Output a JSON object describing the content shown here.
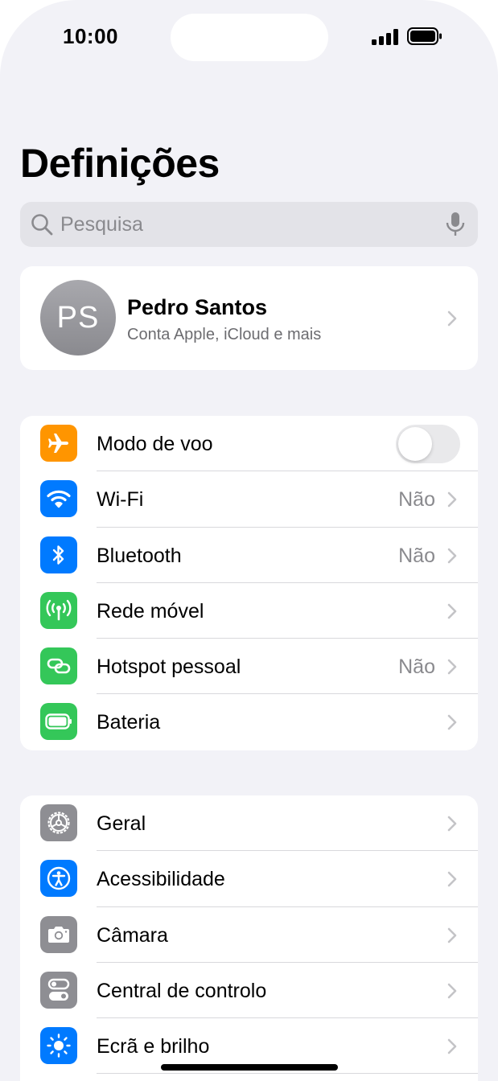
{
  "status_bar": {
    "time": "10:00"
  },
  "title": "Definições",
  "search": {
    "placeholder": "Pesquisa",
    "icon": "search-icon",
    "mic_icon": "microphone-icon"
  },
  "profile": {
    "initials": "PS",
    "name": "Pedro Santos",
    "subtitle": "Conta Apple, iCloud e mais"
  },
  "group1": [
    {
      "label": "Modo de voo",
      "icon": "airplane-icon",
      "color": "#ff9500",
      "toggle_on": false
    },
    {
      "label": "Wi-Fi",
      "value": "Não",
      "icon": "wifi-icon",
      "color": "#007aff"
    },
    {
      "label": "Bluetooth",
      "value": "Não",
      "icon": "bluetooth-icon",
      "color": "#007aff"
    },
    {
      "label": "Rede móvel",
      "icon": "antenna-icon",
      "color": "#34c759"
    },
    {
      "label": "Hotspot pessoal",
      "value": "Não",
      "icon": "hotspot-icon",
      "color": "#34c759"
    },
    {
      "label": "Bateria",
      "icon": "battery-icon",
      "color": "#34c759"
    }
  ],
  "group2": [
    {
      "label": "Geral",
      "icon": "gear-icon",
      "color": "#8e8e93"
    },
    {
      "label": "Acessibilidade",
      "icon": "accessibility-icon",
      "color": "#007aff"
    },
    {
      "label": "Câmara",
      "icon": "camera-icon",
      "color": "#8e8e93"
    },
    {
      "label": "Central de controlo",
      "icon": "control-center-icon",
      "color": "#8e8e93"
    },
    {
      "label": "Ecrã e brilho",
      "icon": "brightness-icon",
      "color": "#007aff"
    }
  ]
}
